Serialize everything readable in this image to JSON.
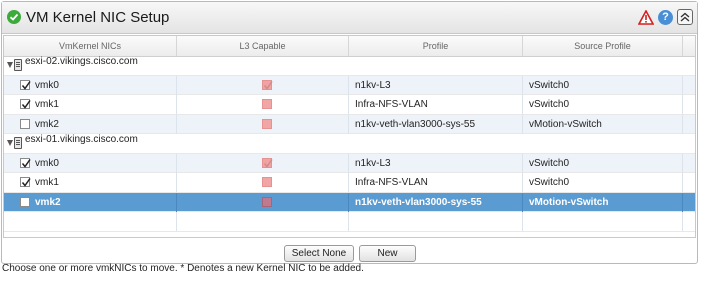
{
  "window": {
    "title": "VM Kernel NIC Setup"
  },
  "grid": {
    "columns": [
      "VmKernel NICs",
      "L3 Capable",
      "Profile",
      "Source Profile"
    ],
    "hosts": [
      {
        "name": "esxi-02.vikings.cisco.com",
        "nics": [
          {
            "name": "vmk0",
            "checked": true,
            "l3_capable": true,
            "profile": "n1kv-L3",
            "source_profile": "vSwitch0",
            "selected": false
          },
          {
            "name": "vmk1",
            "checked": true,
            "l3_capable": false,
            "profile": "Infra-NFS-VLAN",
            "source_profile": "vSwitch0",
            "selected": false
          },
          {
            "name": "vmk2",
            "checked": false,
            "l3_capable": false,
            "profile": "n1kv-veth-vlan3000-sys-55",
            "source_profile": "vMotion-vSwitch",
            "selected": false
          }
        ]
      },
      {
        "name": "esxi-01.vikings.cisco.com",
        "nics": [
          {
            "name": "vmk0",
            "checked": true,
            "l3_capable": true,
            "profile": "n1kv-L3",
            "source_profile": "vSwitch0",
            "selected": false
          },
          {
            "name": "vmk1",
            "checked": true,
            "l3_capable": false,
            "profile": "Infra-NFS-VLAN",
            "source_profile": "vSwitch0",
            "selected": false
          },
          {
            "name": "vmk2",
            "checked": false,
            "l3_capable": false,
            "profile": "n1kv-veth-vlan3000-sys-55",
            "source_profile": "vMotion-vSwitch",
            "selected": true
          }
        ]
      }
    ]
  },
  "buttons": {
    "select_none": "Select None",
    "new": "New"
  },
  "footer": {
    "note": "Choose one or more vmkNICs to move. * Denotes a new Kernel NIC to be added."
  },
  "icons": {
    "status": "success-check-icon",
    "warning": "warning-triangle-icon",
    "help": "help-icon",
    "collapse": "collapse-chevron-icon"
  },
  "colors": {
    "selected_row": "#5a9bd1",
    "alt_row": "#eef3f9",
    "l3_indicator": "#f2a5a5"
  }
}
